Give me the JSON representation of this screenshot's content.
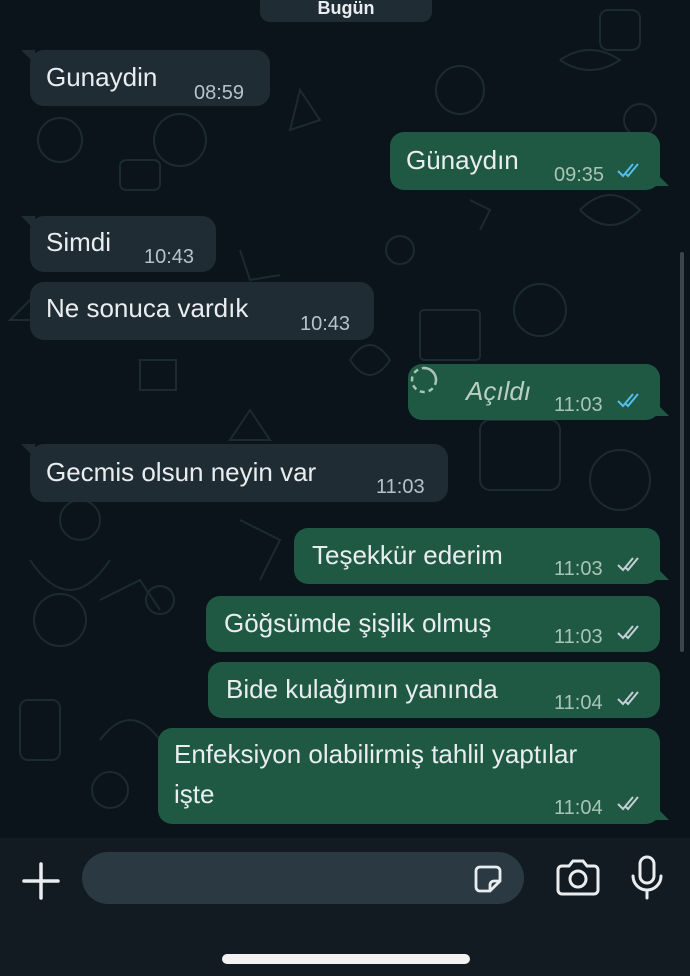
{
  "date_label": "Bugün",
  "messages": [
    {
      "dir": "in",
      "text": "Gunaydin",
      "time": "08:59"
    },
    {
      "dir": "out",
      "text": "Günaydın",
      "time": "09:35",
      "ticks": "read"
    },
    {
      "dir": "in",
      "text": "Simdi",
      "time": "10:43"
    },
    {
      "dir": "in",
      "text": "Ne sonuca vardık",
      "time": "10:43"
    },
    {
      "dir": "out",
      "text": "Açıldı",
      "time": "11:03",
      "ticks": "read",
      "view_once": true
    },
    {
      "dir": "in",
      "text": "Gecmis olsun neyin var",
      "time": "11:03"
    },
    {
      "dir": "out",
      "text": "Teşekkür ederim",
      "time": "11:03",
      "ticks": "delivered"
    },
    {
      "dir": "out",
      "text": "Göğsümde şişlik olmuş",
      "time": "11:03",
      "ticks": "delivered"
    },
    {
      "dir": "out",
      "text": "Bide kulağımın yanında",
      "time": "11:04",
      "ticks": "delivered"
    },
    {
      "dir": "out",
      "text_line1": "Enfeksiyon olabilirmiş tahlil yaptılar",
      "text_line2": "işte",
      "time": "11:04",
      "ticks": "delivered"
    }
  ],
  "composer": {
    "plus_icon": "plus-icon",
    "sticker_icon": "sticker-icon",
    "camera_icon": "camera-icon",
    "mic_icon": "microphone-icon",
    "input_value": ""
  },
  "colors": {
    "background": "#0b141a",
    "incoming_bubble": "#202c33",
    "outgoing_bubble": "#1f5944",
    "read_ticks": "#53bdeb",
    "delivered_ticks": "#c3cfd5"
  }
}
